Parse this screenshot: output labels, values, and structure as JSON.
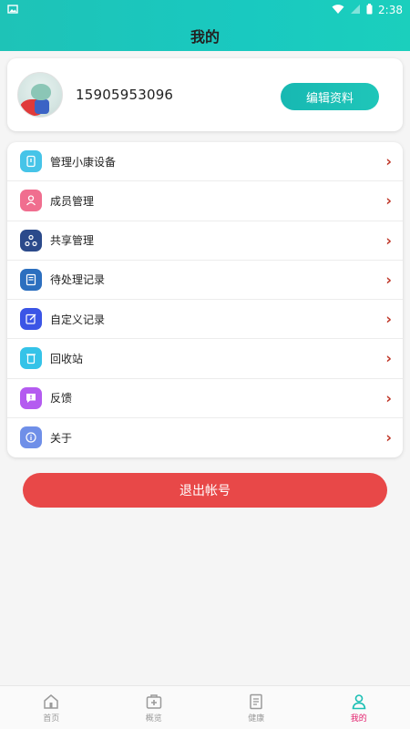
{
  "status_bar": {
    "time": "2:38"
  },
  "header": {
    "title": "我的"
  },
  "profile": {
    "phone": "15905953096",
    "edit_label": "编辑资料"
  },
  "menu": {
    "items": [
      {
        "label": "管理小康设备",
        "icon": "device-icon",
        "color": "#46c4e8"
      },
      {
        "label": "成员管理",
        "icon": "members-icon",
        "color": "#f06e8f"
      },
      {
        "label": "共享管理",
        "icon": "share-icon",
        "color": "#2b4a8b"
      },
      {
        "label": "待处理记录",
        "icon": "pending-record-icon",
        "color": "#2c6fbf"
      },
      {
        "label": "自定义记录",
        "icon": "custom-record-icon",
        "color": "#3b55e6"
      },
      {
        "label": "回收站",
        "icon": "recycle-bin-icon",
        "color": "#35c3e8"
      },
      {
        "label": "反馈",
        "icon": "feedback-icon",
        "color": "#b45bf0"
      },
      {
        "label": "关于",
        "icon": "about-icon",
        "color": "#6f8fe8"
      }
    ]
  },
  "logout": {
    "label": "退出帐号"
  },
  "tabbar": {
    "items": [
      {
        "label": "首页",
        "icon": "home-icon"
      },
      {
        "label": "概览",
        "icon": "overview-icon"
      },
      {
        "label": "健康",
        "icon": "health-icon"
      },
      {
        "label": "我的",
        "icon": "profile-icon"
      }
    ],
    "active": "我的",
    "active_color": "#e3206d"
  }
}
